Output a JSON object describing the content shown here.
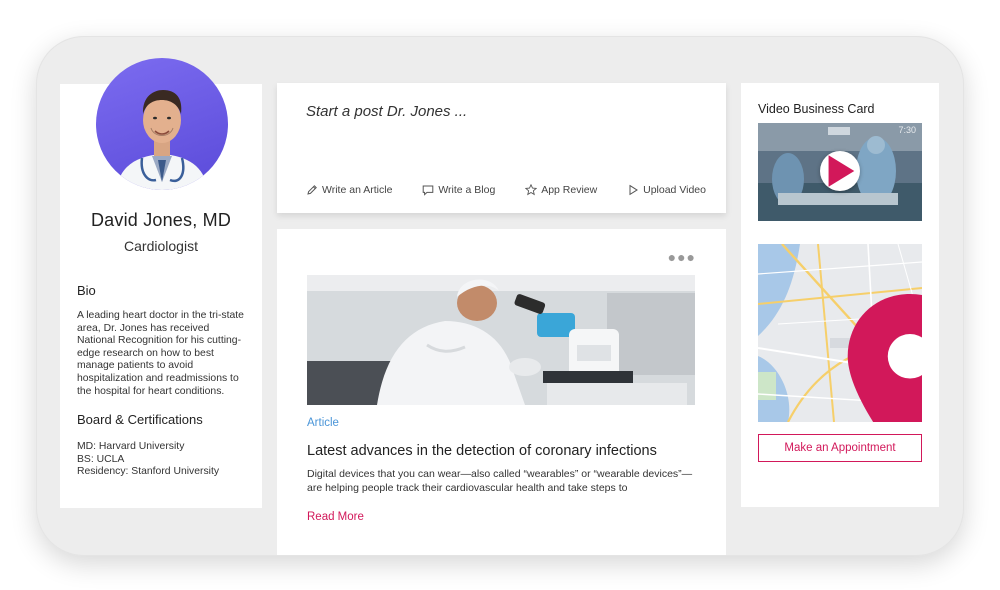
{
  "profile": {
    "name": "David Jones, MD",
    "specialty": "Cardiologist",
    "bio_title": "Bio",
    "bio_text": "A leading heart doctor in the tri-state area, Dr. Jones has received National Recognition for his cutting-edge research on how to best manage patients to avoid hospitalization and readmissions to the hospital for heart conditions.",
    "board_title": "Board & Certifications",
    "certifications": [
      "MD: Harvard University",
      "BS: UCLA",
      "Residency: Stanford University"
    ]
  },
  "composer": {
    "placeholder": "Start a post Dr. Jones ...",
    "actions": [
      {
        "label": "Write an Article",
        "icon": "pencil-icon"
      },
      {
        "label": "Write a Blog",
        "icon": "chat-bubble-icon"
      },
      {
        "label": "App Review",
        "icon": "star-icon"
      },
      {
        "label": "Upload Video",
        "icon": "play-outline-icon"
      }
    ]
  },
  "article": {
    "tag": "Article",
    "title": "Latest advances in the detection of coronary infections",
    "excerpt": "Digital devices that you can wear—also called “wearables” or “wearable devices”—are helping people track their cardiovascular health and take steps to",
    "read_more": "Read More",
    "menu_icon": "more-horizontal-icon"
  },
  "side": {
    "video_title": "Video Business Card",
    "video_time": "7:30",
    "appointment_label": "Make an Appointment",
    "map_icon": "map-pin-icon"
  },
  "colors": {
    "accent": "#d2185a",
    "link": "#4a95d8",
    "avatar_bg": "#6a5ae0",
    "frame": "#ededed"
  }
}
